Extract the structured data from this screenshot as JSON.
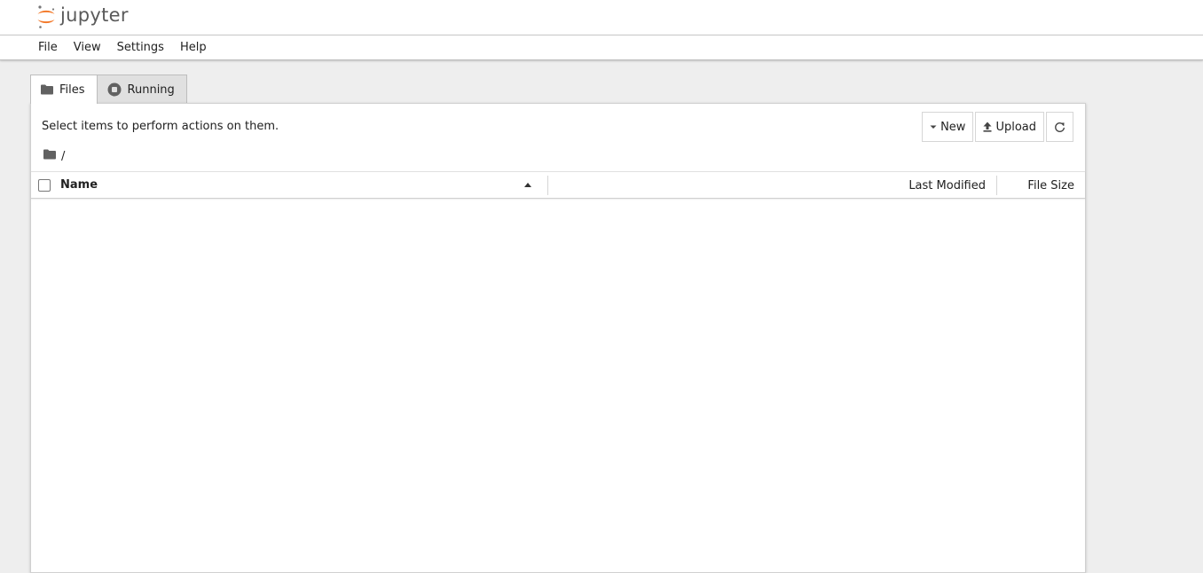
{
  "app": {
    "logo_text": "jupyter",
    "brand_color": "#F37726"
  },
  "menu": [
    {
      "label": "File"
    },
    {
      "label": "View"
    },
    {
      "label": "Settings"
    },
    {
      "label": "Help"
    }
  ],
  "tabs": [
    {
      "label": "Files",
      "icon": "folder-icon",
      "active": true
    },
    {
      "label": "Running",
      "icon": "stop-circle-icon",
      "active": false
    }
  ],
  "toolbar": {
    "hint": "Select items to perform actions on them.",
    "new_label": "New",
    "upload_label": "Upload",
    "refresh_icon": "refresh-icon"
  },
  "breadcrumb": {
    "root_icon": "folder-icon",
    "path": "/"
  },
  "file_list": {
    "columns": {
      "name": "Name",
      "last_modified": "Last Modified",
      "file_size": "File Size"
    },
    "sort": {
      "column": "name",
      "direction": "ascending"
    },
    "rows": []
  }
}
